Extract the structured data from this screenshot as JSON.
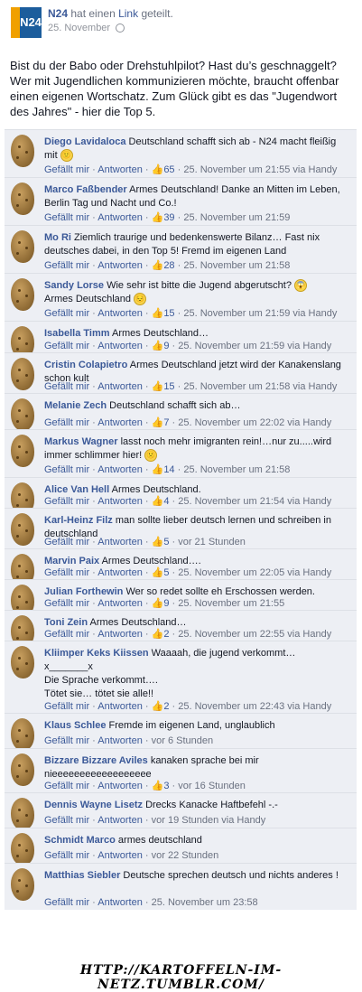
{
  "post": {
    "page_name": "N24",
    "logo_text": "N24",
    "action_pre": "hat einen",
    "action_link": "Link",
    "action_post": "geteilt.",
    "date": "25. November",
    "body": "Bist du der Babo oder Drehstuhlpilot? Hast du’s geschnaggelt? Wer mit Jugendlichen kommunizieren möchte, braucht offenbar einen eigenen Wortschatz. Zum Glück gibt es das \"Jugendwort des Jahres\" - hier die Top 5."
  },
  "labels": {
    "like": "Gefällt mir",
    "reply": "Antworten",
    "sep": "·",
    "like_icon": "👍"
  },
  "comments": [
    {
      "name": "Diego Lavidaloca",
      "text": "Deutschland schafft sich ab - N24 macht fleißig mit",
      "emoji": "🙂",
      "likes": "65",
      "time": "25. November um 21:55 via Handy"
    },
    {
      "name": "Marco Faßbender",
      "text": "Armes Deutschland! Danke an Mitten im Leben, Berlin Tag und Nacht und Co.!",
      "emoji": "",
      "likes": "39",
      "time": "25. November um 21:59"
    },
    {
      "name": "Mo Ri",
      "text": "Ziemlich traurige und bedenkenswerte Bilanz… Fast nix deutsches dabei, in den Top 5! Fremd im eigenen Land",
      "emoji": "",
      "likes": "28",
      "time": "25. November um 21:58"
    },
    {
      "name": "Sandy Lorse",
      "text": "Wie sehr ist bitte die Jugend abgerutscht?",
      "emoji": "😱",
      "text2": "Armes Deutschland",
      "emoji2": "😔",
      "likes": "15",
      "time": "25. November um 21:59 via Handy"
    },
    {
      "name": "Isabella Timm",
      "text": "Armes Deutschland…",
      "emoji": "",
      "likes": "9",
      "time": "25. November um 21:59 via Handy"
    },
    {
      "name": "Cristin Colapietro",
      "text": "Armes Deutschland jetzt wird der Kanakenslang schon kult",
      "emoji": "",
      "likes": "15",
      "time": "25. November um 21:58 via Handy"
    },
    {
      "name": "Melanie Zech",
      "text": "Deutschland schafft sich ab…",
      "emoji": "",
      "likes": "7",
      "time": "25. November um 22:02 via Handy"
    },
    {
      "name": "Markus Wagner",
      "text": "lasst noch mehr imigranten rein!…nur zu.....wird immer schlimmer hier!",
      "emoji": "🙁",
      "likes": "14",
      "time": "25. November um 21:58"
    },
    {
      "name": "Alice Van Hell",
      "text": "Armes Deutschland.",
      "emoji": "",
      "likes": "4",
      "time": "25. November um 21:54 via Handy"
    },
    {
      "name": "Karl-Heinz Filz",
      "text": "man sollte lieber deutsch lernen und schreiben in deutschland",
      "emoji": "",
      "likes": "5",
      "time": "vor 21 Stunden"
    },
    {
      "name": "Marvin Paix",
      "text": "Armes Deutschland….",
      "emoji": "",
      "likes": "5",
      "time": "25. November um 22:05 via Handy"
    },
    {
      "name": "Julian Forthewin",
      "text": "Wer so redet sollte eh Erschossen werden.",
      "emoji": "",
      "likes": "9",
      "time": "25. November um 21:55"
    },
    {
      "name": "Toni Zein",
      "text": "Armes Deutschland…",
      "emoji": "",
      "likes": "2",
      "time": "25. November um 22:55 via Handy"
    },
    {
      "name": "Kliimper Keks Kiissen",
      "text": "Waaaah, die jugend verkommt…",
      "text_lines": [
        "x_______x",
        "Die Sprache verkommt….",
        "Tötet sie… tötet sie alle!!"
      ],
      "emoji": "",
      "likes": "2",
      "time": "25. November um 22:43 via Handy"
    },
    {
      "name": "Klaus Schlee",
      "text": "Fremde im eigenen Land, unglaublich",
      "emoji": "",
      "likes": "",
      "time": "vor 6 Stunden"
    },
    {
      "name": "Bizzare Bizzare Aviles",
      "text": "kanaken sprache bei mir nieeeeeeeeeeeeeeeeee",
      "emoji": "",
      "likes": "3",
      "time": "vor 16 Stunden"
    },
    {
      "name": "Dennis Wayne Lisetz",
      "text": "Drecks Kanacke Haftbefehl -.-",
      "emoji": "",
      "likes": "",
      "time": "vor 19 Stunden via Handy"
    },
    {
      "name": "Schmidt Marco",
      "text": "armes deutschland",
      "emoji": "",
      "likes": "",
      "time": "vor 22 Stunden"
    },
    {
      "name": "Matthias Siebler",
      "text": "Deutsche sprechen deutsch und nichts anderes !",
      "emoji": "",
      "likes": "",
      "time": "25. November um 23:58"
    }
  ],
  "footer": {
    "url": "HTTP://KARTOFFELN-IM-NETZ.TUMBLR.COM/"
  }
}
